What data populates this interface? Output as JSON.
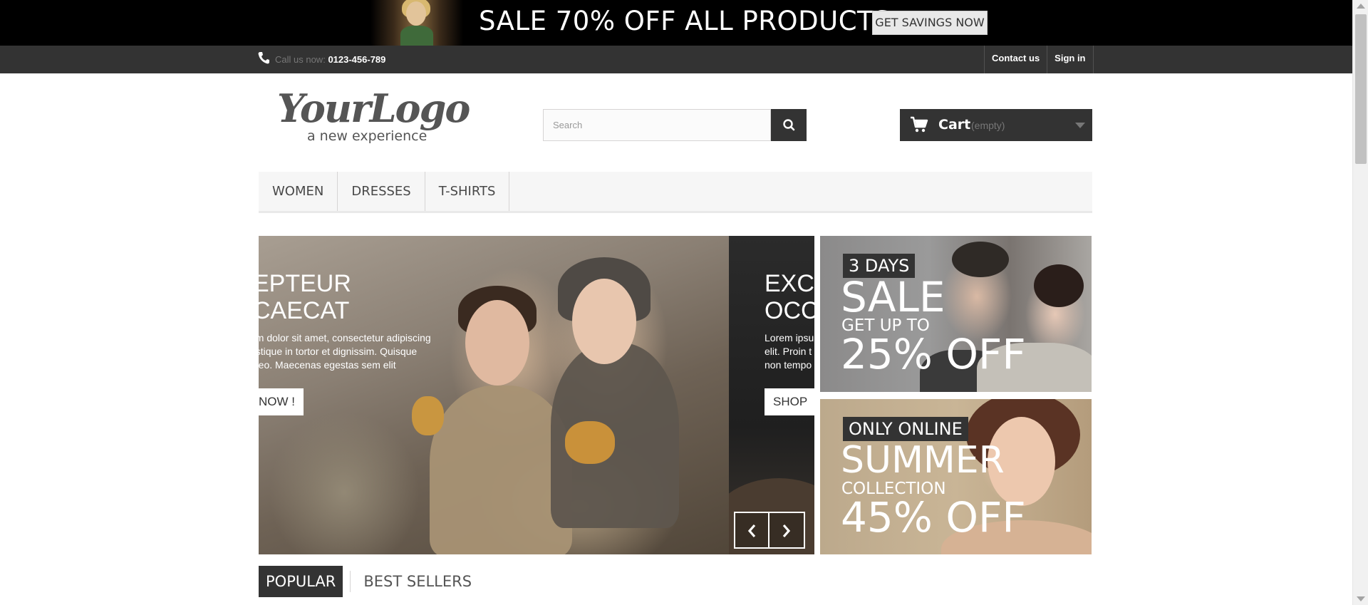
{
  "promo": {
    "headline": "SALE 70% OFF ALL PRODUCTS",
    "button": "GET SAVINGS NOW"
  },
  "navbar": {
    "call_label": "Call us now:",
    "phone": "0123-456-789",
    "contact": "Contact us",
    "signin": "Sign in"
  },
  "header": {
    "logo_main": "YourLogo",
    "logo_sub": "a new experience",
    "search_placeholder": "Search",
    "cart_label": "Cart",
    "cart_status": "(empty)"
  },
  "menu": {
    "items": [
      "WOMEN",
      "DRESSES",
      "T-SHIRTS"
    ]
  },
  "slider": {
    "slide1": {
      "title_line1": "EPTEUR",
      "title_line2": "CAECAT",
      "desc_line1": "um dolor sit amet, consectetur adipiscing",
      "desc_line2": "ristique in tortor et dignissim. Quisque",
      "desc_line3": "r leo. Maecenas egestas sem elit",
      "button": "NOW !"
    },
    "slide2": {
      "title_line1": "EXC",
      "title_line2": "OCC",
      "desc_line1": "Lorem ipsu",
      "desc_line2": "elit. Proin t",
      "desc_line3": "non tempo",
      "button": "SHOP"
    }
  },
  "banners": {
    "banner1": {
      "tag": "3 DAYS",
      "big": "SALE",
      "sub": "GET UP TO",
      "offer": "25% OFF"
    },
    "banner2": {
      "tag": "ONLY ONLINE",
      "big": "SUMMER",
      "sub": "COLLECTION",
      "offer": "45% OFF"
    }
  },
  "tabs": {
    "active": "POPULAR",
    "other": "BEST SELLERS"
  },
  "colors": {
    "dark": "#333333",
    "promo_bg": "#000000",
    "menu_bg": "#f6f6f6"
  },
  "icons": [
    "phone-icon",
    "search-icon",
    "cart-icon",
    "caret-down-icon",
    "chevron-left-icon",
    "chevron-right-icon"
  ]
}
